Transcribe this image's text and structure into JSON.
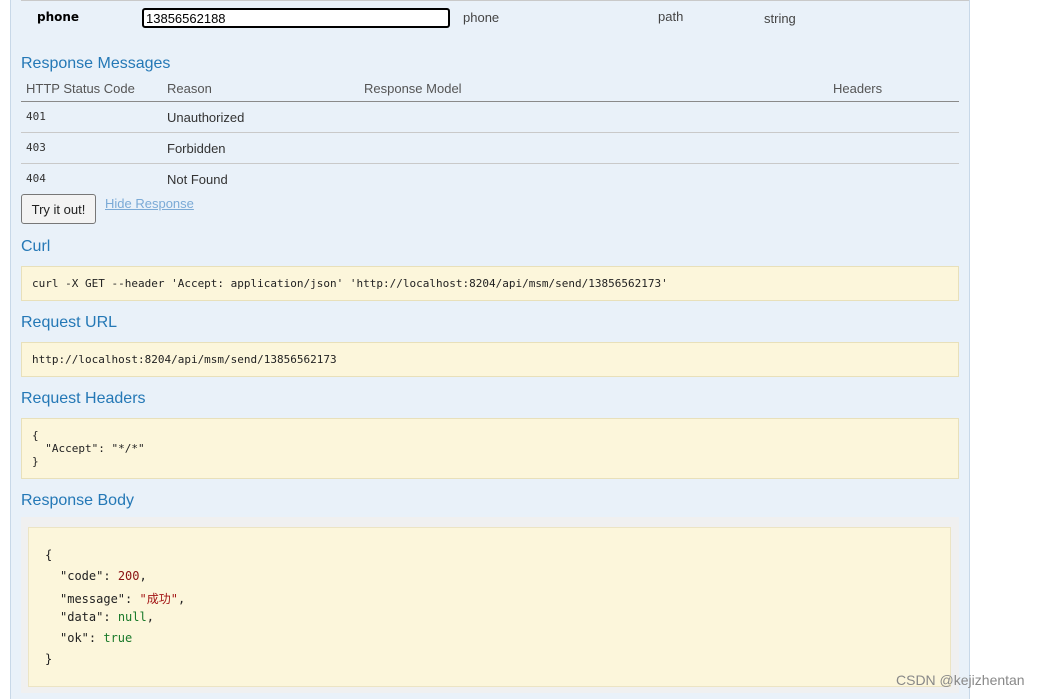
{
  "parameter": {
    "name": "phone",
    "value": "13856562188",
    "description": "phone",
    "param_type": "path",
    "data_type": "string"
  },
  "response_messages": {
    "title": "Response Messages",
    "headers": [
      "HTTP Status Code",
      "Reason",
      "Response Model",
      "Headers"
    ],
    "rows": [
      {
        "code": "401",
        "reason": "Unauthorized"
      },
      {
        "code": "403",
        "reason": "Forbidden"
      },
      {
        "code": "404",
        "reason": "Not Found"
      }
    ]
  },
  "actions": {
    "try_label": "Try it out!",
    "hide_label": "Hide Response"
  },
  "curl": {
    "title": "Curl",
    "command": "curl -X GET --header 'Accept: application/json' 'http://localhost:8204/api/msm/send/13856562173'"
  },
  "request_url": {
    "title": "Request URL",
    "url": "http://localhost:8204/api/msm/send/13856562173"
  },
  "request_headers": {
    "title": "Request Headers",
    "lines": [
      "{",
      "  \"Accept\": \"*/*\"",
      "}"
    ]
  },
  "response_body": {
    "title": "Response Body",
    "open": "{",
    "code_key": "\"code\"",
    "code_val": "200",
    "message_key": "\"message\"",
    "message_val": "\"成功\"",
    "data_key": "\"data\"",
    "data_val": "null",
    "ok_key": "\"ok\"",
    "ok_val": "true",
    "close": "}"
  },
  "watermark": "CSDN @kejizhentan",
  "colors": {
    "heading": "#2478b6",
    "panel_bg": "#e9f1f9",
    "code_bg": "#fcf6db",
    "link": "#7baad6"
  }
}
